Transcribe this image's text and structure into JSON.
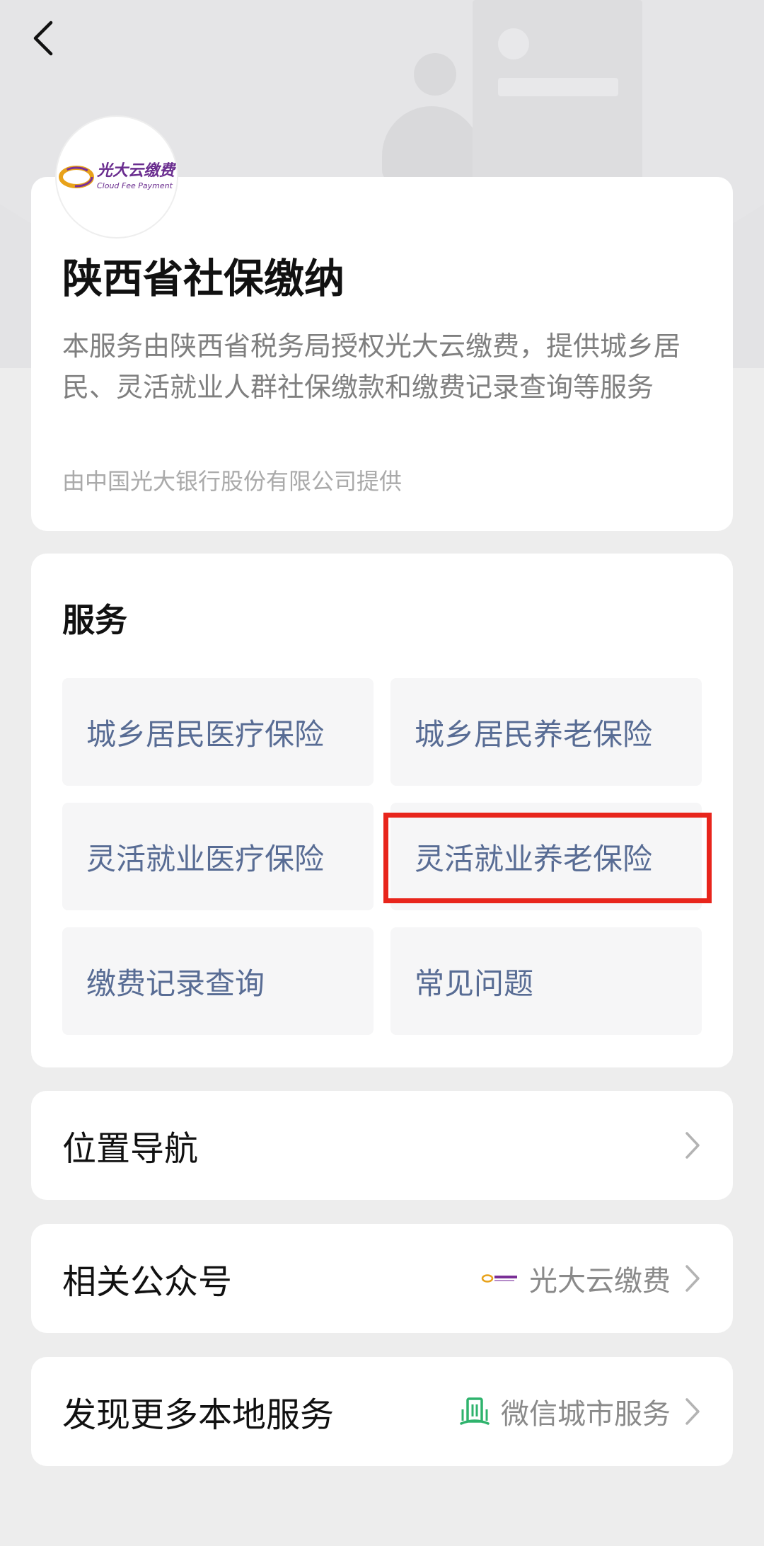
{
  "header": {
    "back_icon": "chevron-left-icon"
  },
  "logo": {
    "text_cn": "光大云缴费",
    "text_en": "Cloud Fee Payment"
  },
  "hero": {
    "title": "陕西省社保缴纳",
    "description": "本服务由陕西省税务局授权光大云缴费，提供城乡居民、灵活就业人群社保缴款和缴费记录查询等服务",
    "provider": "由中国光大银行股份有限公司提供"
  },
  "services": {
    "section_title": "服务",
    "items": [
      {
        "label": "城乡居民医疗保险"
      },
      {
        "label": "城乡居民养老保险"
      },
      {
        "label": "灵活就业医疗保险"
      },
      {
        "label": "灵活就业养老保险"
      },
      {
        "label": "缴费记录查询"
      },
      {
        "label": "常见问题"
      }
    ],
    "highlight_color": "#e8251c"
  },
  "navigation": {
    "label": "位置导航"
  },
  "official_account": {
    "label": "相关公众号",
    "value": "光大云缴费"
  },
  "more_services": {
    "label": "发现更多本地服务",
    "value": "微信城市服务",
    "icon": "city-building-icon"
  },
  "colors": {
    "background": "#ededed",
    "card": "#ffffff",
    "service_text": "#586c94",
    "brand_purple": "#6a2d8f",
    "city_green": "#2fb36d"
  }
}
